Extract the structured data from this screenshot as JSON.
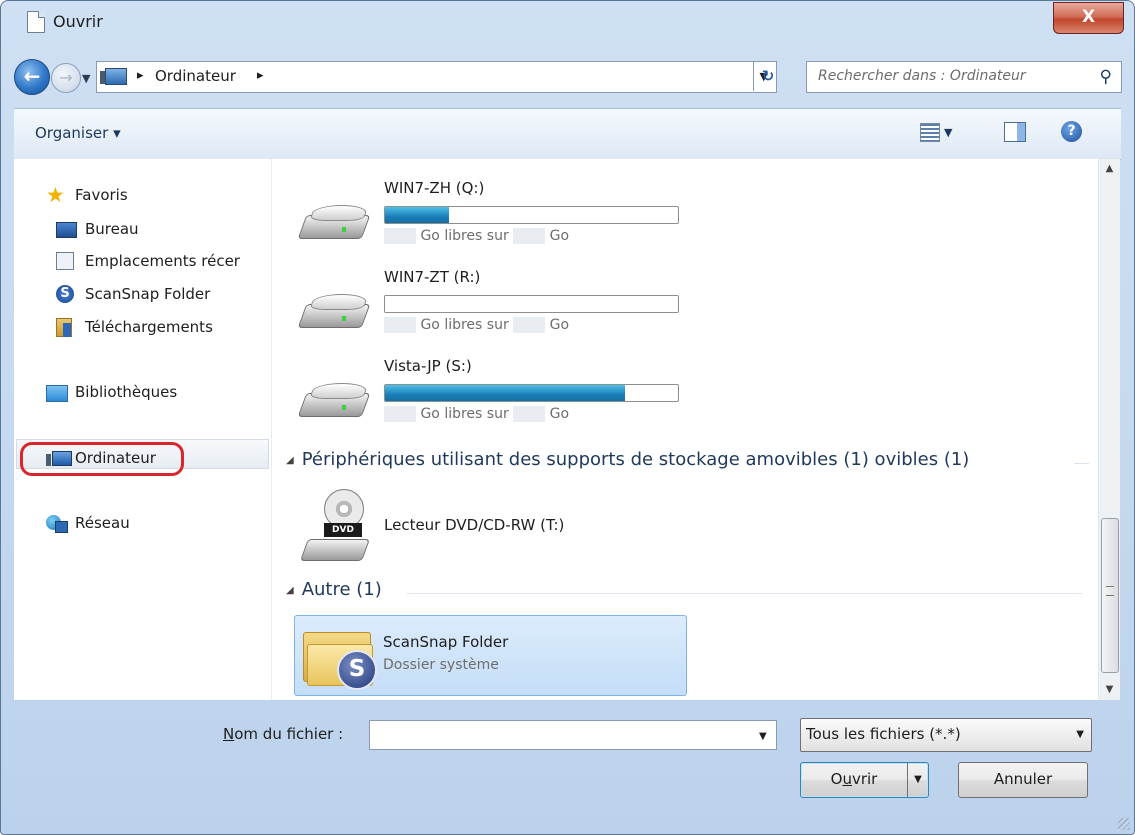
{
  "window": {
    "title": "Ouvrir",
    "close_glyph": "X"
  },
  "address_bar": {
    "path": [
      "Ordinateur"
    ],
    "separator": "▸",
    "search_placeholder": "Rechercher dans : Ordinateur",
    "icons": {
      "back": "back-arrow-icon",
      "forward": "forward-arrow-icon",
      "refresh": "refresh-icon",
      "search": "search-icon"
    }
  },
  "toolbar": {
    "organize_label": "Organiser ▾",
    "icons": [
      "change-view-icon",
      "preview-pane-icon",
      "help-icon"
    ]
  },
  "nav": {
    "favorites": {
      "label": "Favoris",
      "items": [
        {
          "label": "Bureau",
          "icon": "desktop-icon"
        },
        {
          "label": "Emplacements récer",
          "icon": "recent-places-icon"
        },
        {
          "label": "ScanSnap Folder",
          "icon": "scansnap-icon"
        },
        {
          "label": "Téléchargements",
          "icon": "downloads-icon"
        }
      ]
    },
    "libraries": {
      "label": "Bibliothèques"
    },
    "computer": {
      "label": "Ordinateur",
      "selected": true
    },
    "network": {
      "label": "Réseau"
    }
  },
  "content": {
    "drives": [
      {
        "name": "WIN7-ZH (Q:)",
        "used_fraction": 0.22,
        "free_text": "Go libres sur",
        "unit": "Go"
      },
      {
        "name": "WIN7-ZT (R:)",
        "used_fraction": 0.0,
        "free_text": "Go libres sur",
        "unit": "Go"
      },
      {
        "name": "Vista-JP (S:)",
        "used_fraction": 0.82,
        "free_text": "Go libres sur",
        "unit": "Go"
      }
    ],
    "groups": {
      "removable": {
        "label": "Périphériques utilisant des supports de stockage amovibles (1) ovibles (1)"
      },
      "other": {
        "label": "Autre (1)"
      }
    },
    "dvd": {
      "name": "Lecteur DVD/CD-RW (T:)",
      "badge": "DVD"
    },
    "folder": {
      "name": "ScanSnap Folder",
      "subtitle": "Dossier système",
      "badge": "S"
    }
  },
  "bottom": {
    "filename_label_underlined": "N",
    "filename_label_rest": "om du fichier :",
    "filename_value": "",
    "filter_value": "Tous les fichiers (*.*)",
    "open_underlined": "u",
    "open_pre": "O",
    "open_post": "vrir",
    "cancel_label": "Annuler"
  }
}
